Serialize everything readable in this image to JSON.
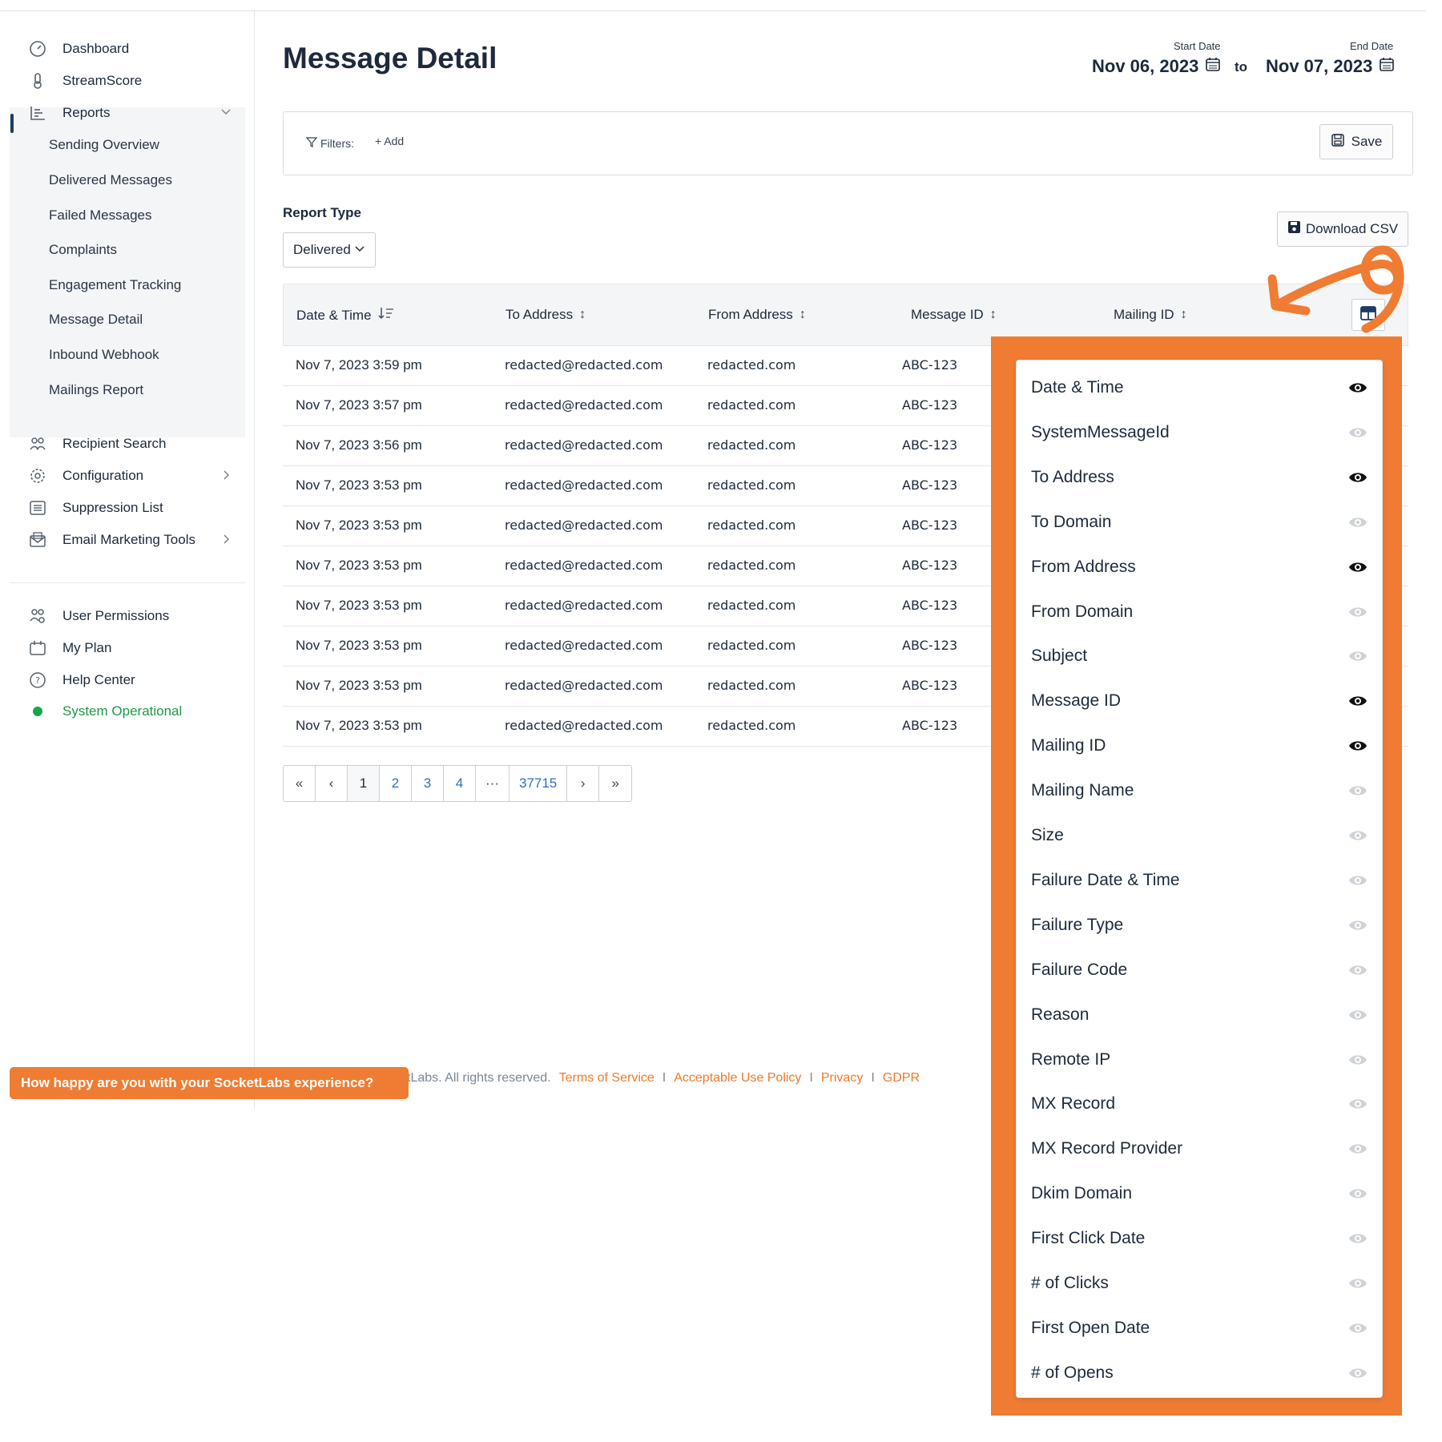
{
  "sidebar": {
    "items": [
      {
        "label": "Dashboard",
        "icon": "dashboard-icon"
      },
      {
        "label": "StreamScore",
        "icon": "thermometer-icon"
      },
      {
        "label": "Reports",
        "icon": "reports-icon"
      },
      {
        "label": "Recipient Search",
        "icon": "users-icon"
      },
      {
        "label": "Configuration",
        "icon": "gear-icon"
      },
      {
        "label": "Suppression List",
        "icon": "list-icon"
      },
      {
        "label": "Email Marketing Tools",
        "icon": "envelope-icon"
      },
      {
        "label": "User Permissions",
        "icon": "user-permissions-icon"
      },
      {
        "label": "My Plan",
        "icon": "calendar-icon"
      },
      {
        "label": "Help Center",
        "icon": "help-icon"
      },
      {
        "label": "System Operational",
        "icon": "status-dot-icon"
      }
    ],
    "report_subitems": [
      "Sending Overview",
      "Delivered Messages",
      "Failed Messages",
      "Complaints",
      "Engagement Tracking",
      "Message Detail",
      "Inbound Webhook",
      "Mailings Report"
    ],
    "active_subitem": "Message Detail"
  },
  "header": {
    "title": "Message Detail",
    "start_label": "Start Date",
    "start_value": "Nov 06, 2023",
    "to_word": "to",
    "end_label": "End Date",
    "end_value": "Nov 07, 2023"
  },
  "filters": {
    "label": "Filters:",
    "add_label": "+ Add",
    "save_label": "Save"
  },
  "report_type": {
    "label": "Report Type",
    "selected": "Delivered",
    "download_label": "Download CSV"
  },
  "table": {
    "columns": [
      "Date & Time",
      "To Address",
      "From Address",
      "Message ID",
      "Mailing ID"
    ],
    "rows": [
      [
        "Nov 7, 2023 3:59 pm",
        "redacted@redacted.com",
        "redacted.com",
        "ABC-123"
      ],
      [
        "Nov 7, 2023 3:57 pm",
        "redacted@redacted.com",
        "redacted.com",
        "ABC-123"
      ],
      [
        "Nov 7, 2023 3:56 pm",
        "redacted@redacted.com",
        "redacted.com",
        "ABC-123"
      ],
      [
        "Nov 7, 2023 3:53 pm",
        "redacted@redacted.com",
        "redacted.com",
        "ABC-123"
      ],
      [
        "Nov 7, 2023 3:53 pm",
        "redacted@redacted.com",
        "redacted.com",
        "ABC-123"
      ],
      [
        "Nov 7, 2023 3:53 pm",
        "redacted@redacted.com",
        "redacted.com",
        "ABC-123"
      ],
      [
        "Nov 7, 2023 3:53 pm",
        "redacted@redacted.com",
        "redacted.com",
        "ABC-123"
      ],
      [
        "Nov 7, 2023 3:53 pm",
        "redacted@redacted.com",
        "redacted.com",
        "ABC-123"
      ],
      [
        "Nov 7, 2023 3:53 pm",
        "redacted@redacted.com",
        "redacted.com",
        "ABC-123"
      ],
      [
        "Nov 7, 2023 3:53 pm",
        "redacted@redacted.com",
        "redacted.com",
        "ABC-123"
      ]
    ]
  },
  "pagination": {
    "first": "«",
    "prev": "‹",
    "pages": [
      "1",
      "2",
      "3",
      "4"
    ],
    "ellipsis": "···",
    "last_page": "37715",
    "next": "›",
    "last": "»",
    "current": "1"
  },
  "column_chooser": {
    "options": [
      {
        "label": "Date & Time",
        "visible": true
      },
      {
        "label": "SystemMessageId",
        "visible": false
      },
      {
        "label": "To Address",
        "visible": true
      },
      {
        "label": "To Domain",
        "visible": false
      },
      {
        "label": "From Address",
        "visible": true
      },
      {
        "label": "From Domain",
        "visible": false
      },
      {
        "label": "Subject",
        "visible": false
      },
      {
        "label": "Message ID",
        "visible": true
      },
      {
        "label": "Mailing ID",
        "visible": true
      },
      {
        "label": "Mailing Name",
        "visible": false
      },
      {
        "label": "Size",
        "visible": false
      },
      {
        "label": "Failure Date & Time",
        "visible": false
      },
      {
        "label": "Failure Type",
        "visible": false
      },
      {
        "label": "Failure Code",
        "visible": false
      },
      {
        "label": "Reason",
        "visible": false
      },
      {
        "label": "Remote IP",
        "visible": false
      },
      {
        "label": "MX Record",
        "visible": false
      },
      {
        "label": "MX Record Provider",
        "visible": false
      },
      {
        "label": "Dkim Domain",
        "visible": false
      },
      {
        "label": "First Click Date",
        "visible": false
      },
      {
        "label": "# of Clicks",
        "visible": false
      },
      {
        "label": "First Open Date",
        "visible": false
      },
      {
        "label": "# of Opens",
        "visible": false
      }
    ]
  },
  "footer": {
    "copyright": "tLabs. All rights reserved.",
    "links": [
      "Terms of Service",
      "Acceptable Use Policy",
      "Privacy",
      "GDPR"
    ],
    "separator": "I"
  },
  "feedback": {
    "label": "How happy are you with your SocketLabs experience?"
  },
  "colors": {
    "accent": "#ef7c32",
    "link": "#2a72b8",
    "status_green": "#18a64a",
    "title": "#1e2a3b"
  }
}
